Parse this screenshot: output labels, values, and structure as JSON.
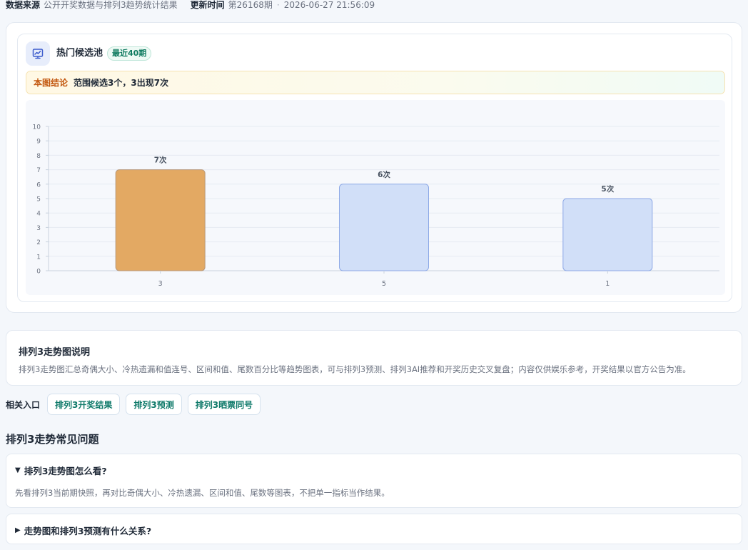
{
  "meta": {
    "source_label": "数据来源",
    "source_value": "公开开奖数据与排列3趋势统计结果",
    "update_label": "更新时间",
    "issue": "第26168期",
    "separator": "·",
    "time": "2026-06-27 21:56:09"
  },
  "pool": {
    "icon": "chart-board-icon",
    "title": "热门候选池",
    "badge": "最近40期",
    "conclusion_label": "本图结论",
    "conclusion_text": "范围候选3个，3出现7次"
  },
  "chart_data": {
    "type": "bar",
    "categories": [
      "3",
      "5",
      "1"
    ],
    "values": [
      7,
      6,
      5
    ],
    "data_labels": [
      "7次",
      "6次",
      "5次"
    ],
    "ylim": [
      0,
      10
    ],
    "yticks": [
      "0",
      "1",
      "2",
      "3",
      "4",
      "5",
      "6",
      "7",
      "8",
      "9",
      "10"
    ],
    "grid": true,
    "highlight_index": 0,
    "colors": {
      "highlight_fill": "#e3a963",
      "highlight_stroke": "#b8987a",
      "bar_fill": "#d1dff8",
      "bar_stroke": "#8ea9e6",
      "grid": "#e6ebf2",
      "axis": "#c9d2de",
      "tick_text": "#6b7280",
      "label_text": "#4b5563"
    }
  },
  "desc": {
    "title": "排列3走势图说明",
    "text": "排列3走势图汇总奇偶大小、冷热遗漏和值连号、区间和值、尾数百分比等趋势图表，可与排列3预测、排列3AI推荐和开奖历史交叉复盘；内容仅供娱乐参考，开奖结果以官方公告为准。"
  },
  "links": {
    "label": "相关入口",
    "items": [
      "排列3开奖结果",
      "排列3预测",
      "排列3晒票同号"
    ]
  },
  "faq": {
    "heading": "排列3走势常见问题",
    "items": [
      {
        "marker": "▼",
        "question": "排列3走势图怎么看?",
        "answer": "先看排列3当前期快照，再对比奇偶大小、冷热遗漏、区间和值、尾数等图表，不把单一指标当作结果。"
      },
      {
        "marker": "▶",
        "question": "走势图和排列3预测有什么关系?"
      }
    ]
  }
}
